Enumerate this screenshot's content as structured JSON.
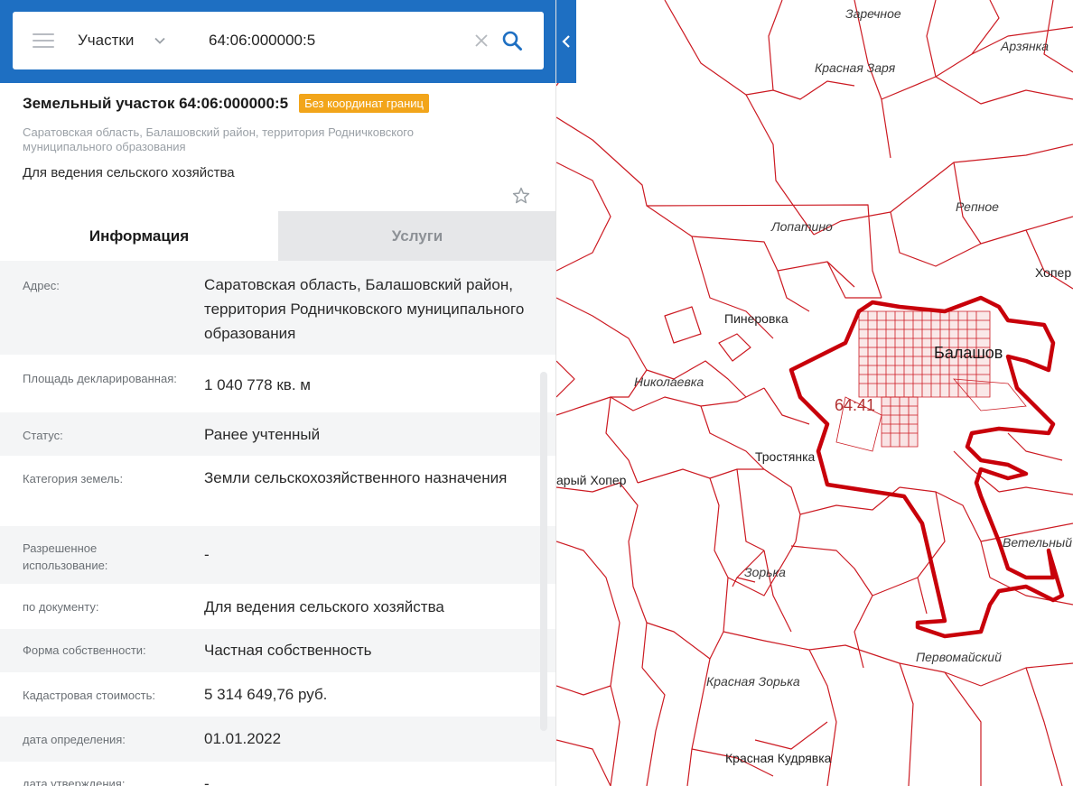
{
  "search": {
    "type_label": "Участки",
    "query": "64:06:000000:5"
  },
  "parcel": {
    "title": "Земельный участок 64:06:000000:5",
    "badge": "Без координат границ",
    "address": "Саратовская область, Балашовский район, территория Родничковского муниципального образования",
    "purpose": "Для ведения сельского хозяйства"
  },
  "tabs": [
    {
      "label": "Информация",
      "active": true
    },
    {
      "label": "Услуги",
      "active": false
    }
  ],
  "info": [
    {
      "key": "Адрес:",
      "value": "Саратовская область, Балашовский район, территория Родничковского муниципального образования"
    },
    {
      "key": "Площадь декларированная:",
      "value": "1 040 778 кв. м"
    },
    {
      "key": "Статус:",
      "value": "Ранее учтенный"
    },
    {
      "key": "Категория земель:",
      "value": "Земли сельскохозяйственного назначения"
    },
    {
      "key": "Разрешенное использование:",
      "value": "-"
    },
    {
      "key": "по документу:",
      "value": "Для ведения сельского хозяйства"
    },
    {
      "key": "Форма собственности:",
      "value": "Частная собственность"
    },
    {
      "key": "Кадастровая стоимость:",
      "value": "5 314 649,76 руб."
    },
    {
      "key": "дата определения:",
      "value": "01.01.2022"
    },
    {
      "key": "дата утверждения:",
      "value": "-"
    }
  ],
  "map": {
    "places": {
      "zarechnoe": "Заречное",
      "arzyanka": "Арзянка",
      "krasnaya_zarya": "Красная Заря",
      "repnoe": "Репное",
      "lopatino": "Лопатино",
      "khoper": "Хопер",
      "pinerovka": "Пинеровка",
      "balashov": "Балашов",
      "nikolaevka": "Николаевка",
      "district_code": "64:41",
      "tростyanka": "Тростянка",
      "stary_khoper": "арый Хопер",
      "vetelny": "Ветельный",
      "zorka": "Зорька",
      "pervomaisky": "Первомайский",
      "krasnaya_zorka": "Красная Зорька",
      "krasnaya_kudryavka": "Красная Кудрявка"
    },
    "colors": {
      "boundary": "#c8000a",
      "line": "#cc1a22",
      "accent": "#1e6fc2",
      "badge": "#f2a51a"
    }
  }
}
